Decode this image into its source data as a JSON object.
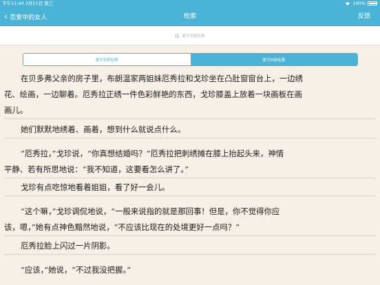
{
  "status_bar": {
    "time_date": "下午11:44  3月11日 周三",
    "battery_percent": "100%",
    "battery_level": 1.0
  },
  "nav": {
    "back_label": "恋爱中的女人",
    "title": "检索",
    "feedback_label": "反馈"
  },
  "search": {
    "placeholder": "章节内容检索"
  },
  "segments": {
    "items": [
      "章节名称检索",
      "章节内容检索"
    ],
    "selected": 1
  },
  "paragraphs": [
    {
      "lines": [
        "在贝多弗父亲的房子里，布朗温家两姐妹厄秀拉和戈珍坐在凸肚窗窗台上，一边绣",
        "花、绘画，一边聊着。厄秀拉正绣一件色彩鲜艳的东西，戈珍膝盖上放着一块画板在画",
        "画儿。"
      ]
    },
    {
      "lines": [
        "她们默默地绣着、画着，想到什么就说点什么。"
      ]
    },
    {
      "lines": [
        "“厄秀拉，”戈珍说，“你真想结婚吗？”厄秀拉把刺绣摊在膝上抬起头来，神情",
        "平静、若有所思地说：“我不知道，这要看怎么讲了。”"
      ]
    },
    {
      "lines": [
        "戈珍有点吃惊地看着姐姐，看了好一会儿。"
      ]
    },
    {
      "lines": [
        "“这个嘛，”戈珍调侃地说，“一般来说指的就是那回事！但是，你不觉得你应",
        "该，嗯，”她有点神色黯然地说，“不应该比现在的处境更好一点吗？”"
      ]
    },
    {
      "lines": [
        "厄秀拉脸上闪过一片阴影。"
      ]
    },
    {
      "lines": [
        "“应该，”她说，“不过我没把握。”"
      ]
    }
  ]
}
